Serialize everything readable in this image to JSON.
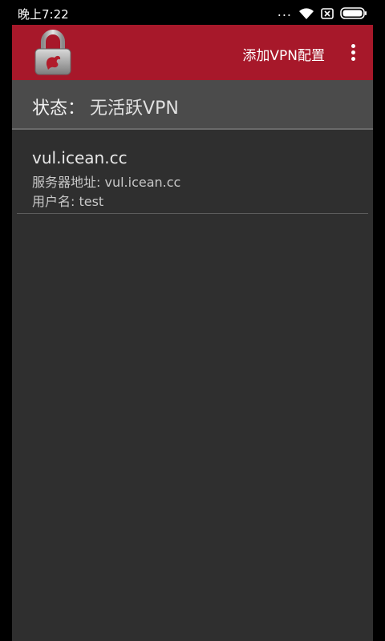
{
  "statusbar": {
    "time": "晚上7:22",
    "signal_dots": "..."
  },
  "toolbar": {
    "app_icon": "padlock-icon",
    "add_vpn_label": "添加VPN配置",
    "overflow_icon": "more-vert-icon"
  },
  "status": {
    "label": "状态：",
    "value": "无活跃VPN"
  },
  "vpn_list": [
    {
      "name": "vul.icean.cc",
      "server_line": "服务器地址: vul.icean.cc",
      "user_line": "用户名: test"
    }
  ],
  "colors": {
    "toolbar": "#a7182a",
    "background": "#2f2f2f",
    "status_row": "#4b4b4b"
  }
}
